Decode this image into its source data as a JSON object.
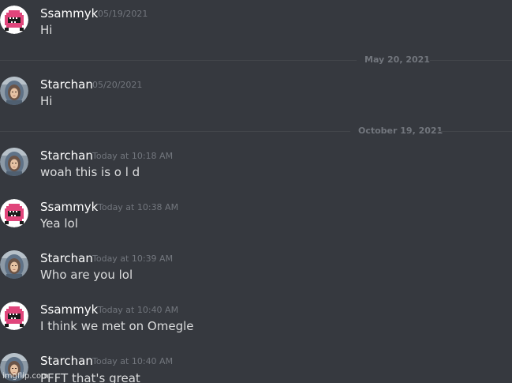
{
  "messages": [
    {
      "user": "Ssammyk",
      "time": "05/19/2021",
      "text": "Hi",
      "avatar": "pink-monster-icon"
    },
    {
      "user": "Starchan",
      "time": "05/20/2021",
      "text": "Hi",
      "avatar": "hooded-girl-avatar"
    },
    {
      "user": "Starchan",
      "time": "Today at 10:18 AM",
      "text": "woah this is o l d",
      "avatar": "hooded-girl-avatar"
    },
    {
      "user": "Ssammyk",
      "time": "Today at 10:38 AM",
      "text": "Yea lol",
      "avatar": "pink-monster-icon"
    },
    {
      "user": "Starchan",
      "time": "Today at 10:39 AM",
      "text": "Who are you lol",
      "avatar": "hooded-girl-avatar"
    },
    {
      "user": "Ssammyk",
      "time": "Today at 10:40 AM",
      "text": "I think we met on Omegle",
      "avatar": "pink-monster-icon"
    },
    {
      "user": "Starchan",
      "time": "Today at 10:40 AM",
      "text": "PFFT that's great",
      "avatar": "hooded-girl-avatar"
    }
  ],
  "dividers": [
    {
      "label": "May 20, 2021"
    },
    {
      "label": "October 19, 2021"
    }
  ],
  "watermark": "imgflip.com",
  "colors": {
    "background": "#36393f",
    "username": "#ffffff",
    "message_text": "#dcddde",
    "timestamp": "#72767d",
    "divider": "#42454a",
    "monster_pink": "#e0457b"
  }
}
